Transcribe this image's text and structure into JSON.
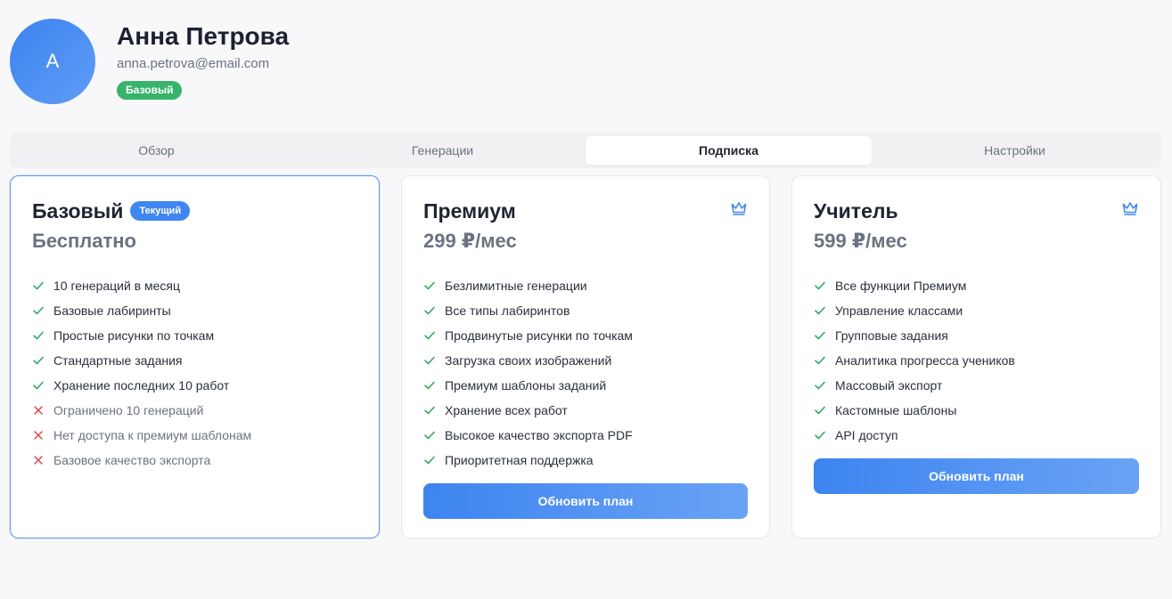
{
  "profile": {
    "avatar_letter": "A",
    "name": "Анна Петрова",
    "email": "anna.petrova@email.com",
    "plan_badge": "Базовый"
  },
  "tabs": [
    {
      "label": "Обзор"
    },
    {
      "label": "Генерации"
    },
    {
      "label": "Подписка",
      "active": true
    },
    {
      "label": "Настройки"
    }
  ],
  "plans": [
    {
      "name": "Базовый",
      "badge": "Текущий",
      "price": "Бесплатно",
      "features": [
        "10 генераций в месяц",
        "Базовые лабиринты",
        "Простые рисунки по точкам",
        "Стандартные задания",
        "Хранение последних 10 работ"
      ],
      "limitations": [
        "Ограничено 10 генераций",
        "Нет доступа к премиум шаблонам",
        "Базовое качество экспорта"
      ]
    },
    {
      "name": "Премиум",
      "icon": "crown-icon",
      "price": "299 ₽/мес",
      "features": [
        "Безлимитные генерации",
        "Все типы лабиринтов",
        "Продвинутые рисунки по точкам",
        "Загрузка своих изображений",
        "Премиум шаблоны заданий",
        "Хранение всех работ",
        "Высокое качество экспорта PDF",
        "Приоритетная поддержка"
      ],
      "button": "Обновить план"
    },
    {
      "name": "Учитель",
      "icon": "crown-icon",
      "price": "599 ₽/мес",
      "features": [
        "Все функции Премиум",
        "Управление классами",
        "Групповые задания",
        "Аналитика прогресса учеников",
        "Массовый экспорт",
        "Кастомные шаблоны",
        "API доступ"
      ],
      "button": "Обновить план"
    }
  ],
  "colors": {
    "accent": "#3f86f1",
    "success": "#38b36b",
    "check": "#2fa866",
    "cross": "#e0464b"
  }
}
